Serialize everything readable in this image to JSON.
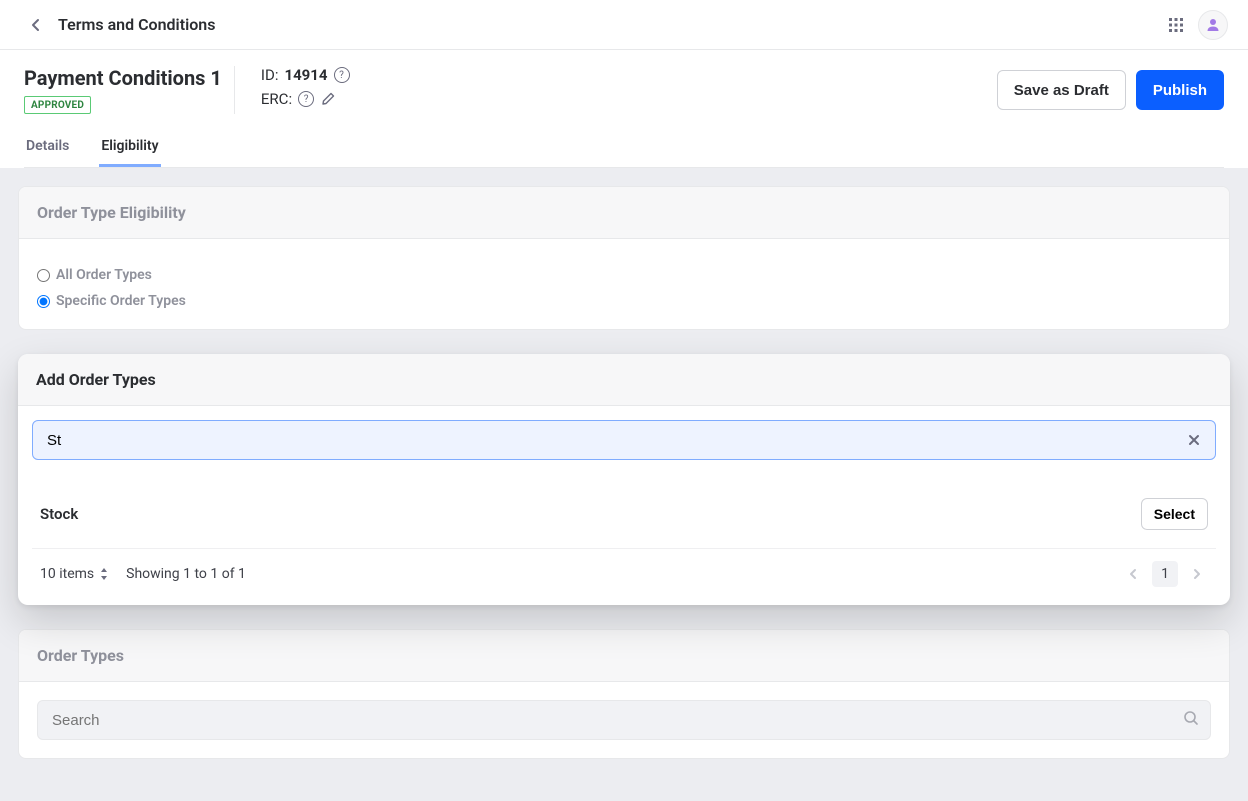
{
  "topbar": {
    "title": "Terms and Conditions"
  },
  "header": {
    "title": "Payment Conditions 1",
    "badge": "APPROVED",
    "id_label": "ID:",
    "id_value": "14914",
    "erc_label": "ERC:"
  },
  "actions": {
    "save_draft": "Save as Draft",
    "publish": "Publish"
  },
  "tabs": {
    "details": "Details",
    "eligibility": "Eligibility"
  },
  "order_type_panel": {
    "title": "Order Type Eligibility",
    "all_label": "All Order Types",
    "specific_label": "Specific Order Types"
  },
  "add_types": {
    "title": "Add Order Types",
    "search_value": "St",
    "result_name": "Stock",
    "select_label": "Select",
    "items_label": "10 items",
    "showing_label": "Showing 1 to 1 of 1",
    "page_num": "1"
  },
  "order_types": {
    "title": "Order Types",
    "search_placeholder": "Search"
  }
}
